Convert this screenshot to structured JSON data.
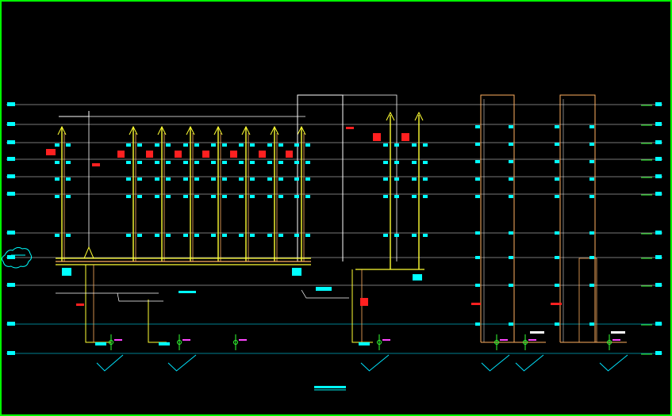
{
  "view": {
    "background": "#000000",
    "frame_color": "#00ff00"
  },
  "colors": {
    "floor_line": "#d8d8d8",
    "ground_line": "#00e5ff",
    "pipe_yellow": "#ffff33",
    "pipe_orange": "#ffb060",
    "pipe_white": "#ffffff",
    "tag_cyan": "#00ffff",
    "tag_red": "#ff2020",
    "tag_green": "#33ff33",
    "tag_magenta": "#ff44ff"
  },
  "diagram": {
    "type": "plumbing-riser-elevation",
    "floor_levels": 11,
    "systems": [
      "left-riser-bank",
      "center-riser-pair",
      "right-riser-pair-a",
      "right-riser-pair-b"
    ],
    "cloud_marker_icon": "revision-cloud-icon",
    "title_bar_icon": "drawing-title-bar"
  }
}
